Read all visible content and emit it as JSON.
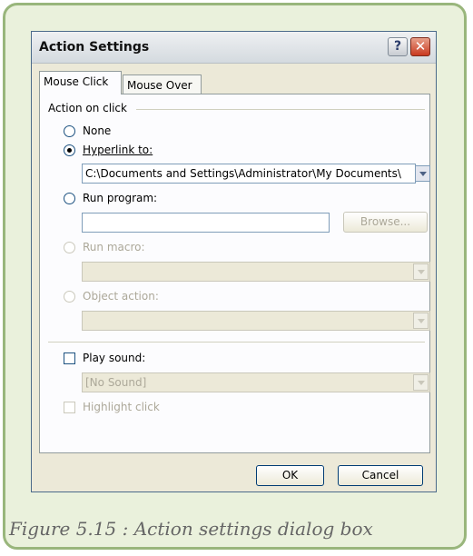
{
  "dialog": {
    "title": "Action Settings",
    "help_glyph": "?",
    "close_glyph": "✕"
  },
  "tabs": [
    {
      "label": "Mouse Click",
      "active": true
    },
    {
      "label": "Mouse Over",
      "active": false
    }
  ],
  "group": {
    "label": "Action on click"
  },
  "options": {
    "none": {
      "label": "None",
      "selected": false,
      "enabled": true
    },
    "hyperlink": {
      "label": "Hyperlink to:",
      "selected": true,
      "enabled": true,
      "value": "C:\\Documents and Settings\\Administrator\\My Documents\\"
    },
    "run_program": {
      "label": "Run program:",
      "selected": false,
      "enabled": true,
      "value": ""
    },
    "run_macro": {
      "label": "Run macro:",
      "selected": false,
      "enabled": false,
      "value": ""
    },
    "object_action": {
      "label": "Object action:",
      "selected": false,
      "enabled": false,
      "value": ""
    }
  },
  "browse_button": {
    "label": "Browse..."
  },
  "play_sound": {
    "label": "Play sound:",
    "checked": false,
    "value": "[No Sound]"
  },
  "highlight_click": {
    "label": "Highlight click",
    "checked": false,
    "enabled": false
  },
  "buttons": {
    "ok": "OK",
    "cancel": "Cancel"
  },
  "caption": "Figure 5.15 : Action settings dialog box",
  "colors": {
    "frame_border": "#99b67c",
    "frame_bg": "#eaf1dc",
    "dialog_bg": "#ece9d8",
    "caption": "#666666"
  }
}
